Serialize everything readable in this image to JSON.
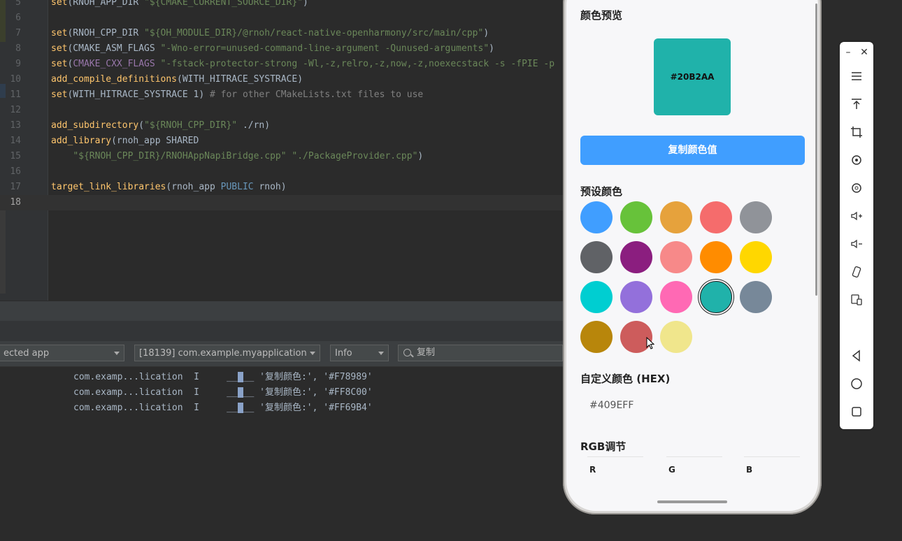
{
  "editor": {
    "lines": [
      {
        "num": "5",
        "tokens": [
          {
            "t": "set",
            "c": "fn"
          },
          {
            "t": "(RNOH_APP_DIR ",
            "c": "plain"
          },
          {
            "t": "\"${CMAKE_CURRENT_SOURCE_DIR}\"",
            "c": "str"
          },
          {
            "t": ")",
            "c": "plain"
          }
        ]
      },
      {
        "num": "6",
        "tokens": []
      },
      {
        "num": "7",
        "tokens": [
          {
            "t": "set",
            "c": "fn"
          },
          {
            "t": "(RNOH_CPP_DIR ",
            "c": "plain"
          },
          {
            "t": "\"${OH_MODULE_DIR}/@rnoh/react-native-openharmony/src/main/cpp\"",
            "c": "str"
          },
          {
            "t": ")",
            "c": "plain"
          }
        ]
      },
      {
        "num": "8",
        "tokens": [
          {
            "t": "set",
            "c": "fn"
          },
          {
            "t": "(CMAKE_ASM_FLAGS ",
            "c": "plain"
          },
          {
            "t": "\"-Wno-error=unused-command-line-argument -Qunused-arguments\"",
            "c": "str"
          },
          {
            "t": ")",
            "c": "plain"
          }
        ]
      },
      {
        "num": "9",
        "tokens": [
          {
            "t": "set",
            "c": "fn"
          },
          {
            "t": "(",
            "c": "plain"
          },
          {
            "t": "CMAKE_CXX_FLAGS",
            "c": "var"
          },
          {
            "t": " ",
            "c": "plain"
          },
          {
            "t": "\"-fstack-protector-strong -Wl,-z,relro,-z,now,-z,noexecstack -s -fPIE -p",
            "c": "str"
          }
        ]
      },
      {
        "num": "10",
        "tokens": [
          {
            "t": "add_compile_definitions",
            "c": "fn"
          },
          {
            "t": "(WITH_HITRACE_SYSTRACE)",
            "c": "plain"
          }
        ]
      },
      {
        "num": "11",
        "tokens": [
          {
            "t": "set",
            "c": "fn"
          },
          {
            "t": "(WITH_HITRACE_SYSTRACE 1) ",
            "c": "plain"
          },
          {
            "t": "# for other CMakeLists.txt files to use",
            "c": "cmt"
          }
        ]
      },
      {
        "num": "12",
        "tokens": []
      },
      {
        "num": "13",
        "tokens": [
          {
            "t": "add_subdirectory",
            "c": "fn"
          },
          {
            "t": "(",
            "c": "plain"
          },
          {
            "t": "\"${RNOH_CPP_DIR}\"",
            "c": "str"
          },
          {
            "t": " ./rn)",
            "c": "plain"
          }
        ]
      },
      {
        "num": "14",
        "tokens": [
          {
            "t": "add_library",
            "c": "fn"
          },
          {
            "t": "(rnoh_app SHARED",
            "c": "plain"
          }
        ]
      },
      {
        "num": "15",
        "tokens": [
          {
            "t": "    ",
            "c": "plain"
          },
          {
            "t": "\"${RNOH_CPP_DIR}/RNOHAppNapiBridge.cpp\"",
            "c": "str"
          },
          {
            "t": " ",
            "c": "plain"
          },
          {
            "t": "\"./PackageProvider.cpp\"",
            "c": "str"
          },
          {
            "t": ")",
            "c": "plain"
          }
        ]
      },
      {
        "num": "16",
        "tokens": []
      },
      {
        "num": "17",
        "tokens": [
          {
            "t": "target_link_libraries",
            "c": "fn"
          },
          {
            "t": "(rnoh_app ",
            "c": "plain"
          },
          {
            "t": "PUBLIC",
            "c": "id"
          },
          {
            "t": " rnoh)",
            "c": "plain"
          }
        ]
      },
      {
        "num": "18",
        "tokens": []
      }
    ]
  },
  "logcat": {
    "device_select": "ected app",
    "process_select": "[18139] com.example.myapplication",
    "level_select": "Info",
    "search_value": "复制",
    "lines": [
      {
        "tag": "com.examp...lication",
        "level": "I",
        "msg": "'复制颜色:', '#F78989'"
      },
      {
        "tag": "com.examp...lication",
        "level": "I",
        "msg": "'复制颜色:', '#FF8C00'"
      },
      {
        "tag": "com.examp...lication",
        "level": "I",
        "msg": "'复制颜色:', '#FF69B4'"
      }
    ]
  },
  "phone": {
    "preview_title": "颜色预览",
    "preview_color": "#20B2AA",
    "preview_label": "#20B2AA",
    "copy_button": "复制颜色值",
    "copy_button_color": "#409EFF",
    "preset_title": "预设颜色",
    "presets": [
      "#409EFF",
      "#67C23A",
      "#E6A23C",
      "#F56C6C",
      "#909399",
      "#606266",
      "#8B1E7F",
      "#F78989",
      "#FF8C00",
      "#FFD700",
      "#00CED1",
      "#9370DB",
      "#FF69B4",
      "#20B2AA",
      "#778899",
      "#B8860B",
      "#CD5C5C",
      "#F0E68C"
    ],
    "selected_preset": "#20B2AA",
    "custom_title": "自定义颜色 (HEX)",
    "hex_value": "#409EFF",
    "rgb_title": "RGB调节",
    "rgb_labels": [
      "R",
      "G",
      "B"
    ]
  },
  "side_panel": {
    "buttons": [
      "menu-icon",
      "pin-top-icon",
      "crop-icon",
      "rotate-left-icon",
      "rotate-right-icon",
      "volume-up-icon",
      "volume-down-icon",
      "shake-icon",
      "multi-device-icon",
      "back-icon",
      "home-icon",
      "recents-icon"
    ]
  }
}
